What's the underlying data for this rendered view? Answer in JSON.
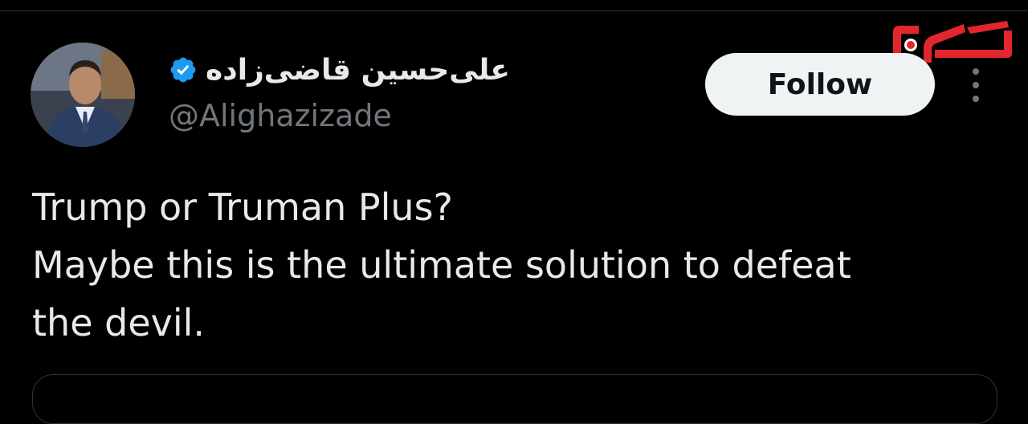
{
  "tweet": {
    "author": {
      "display_name": "علی‌حسین قاضی‌زاده",
      "handle": "@Alighazizade",
      "verified_icon": "verified-badge-icon",
      "verified_color": "#1d9bf0"
    },
    "follow_label": "Follow",
    "text_lines": [
      "Trump or Truman Plus?",
      "Maybe this is the ultimate solution to defeat",
      "the devil."
    ],
    "more_icon": "more-vertical-icon"
  },
  "logo": {
    "icon": "news-site-logo",
    "color": "#e3262d"
  },
  "colors": {
    "background": "#000000",
    "primary_text": "#e7e9ea",
    "secondary_text": "#71767b",
    "follow_button_bg": "#eff3f4",
    "border": "#2f3336"
  }
}
